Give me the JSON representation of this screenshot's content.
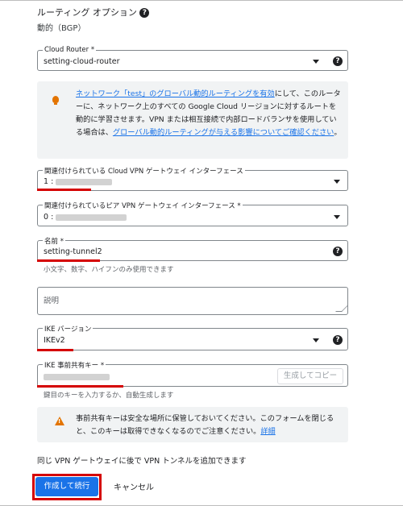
{
  "routing_options": {
    "title": "ルーティング オプション",
    "mode": "動的（BGP）"
  },
  "cloud_router": {
    "label": "Cloud Router *",
    "value": "setting-cloud-router"
  },
  "info": {
    "link1": "ネットワーク「test」のグローバル動的ルーティングを有効",
    "text1": "にして、このルーターに、ネットワーク上のすべての Google Cloud リージョンに対するルートを動的に学習させます。VPN または相互接続で内部ロードバランサを使用している場合は、",
    "link2": "グローバル動的ルーティングが与える影響についてご確認ください",
    "text2": "。"
  },
  "cloud_vpn_interface": {
    "label": "関連付けられている Cloud VPN ゲートウェイ インターフェース",
    "prefix": "1 :"
  },
  "peer_vpn_interface": {
    "label": "関連付けられているピア VPN ゲートウェイ インターフェース *",
    "prefix": "0 :"
  },
  "name": {
    "label": "名前 *",
    "value": "setting-tunnel2",
    "hint": "小文字、数字、ハイフンのみ使用できます"
  },
  "description": {
    "placeholder": "説明"
  },
  "ike_version": {
    "label": "IKE バージョン",
    "value": "IKEv2"
  },
  "ike_key": {
    "label": "IKE 事前共有キー *",
    "generate_label": "生成してコピー",
    "hint": "鍵目のキーを入力するか、自動生成します"
  },
  "warning": {
    "text": "事前共有キーは安全な場所に保管しておいてください。このフォームを閉じると、このキーは取得できなくなるのでご注意ください。",
    "link": "詳細"
  },
  "footer": {
    "note": "同じ VPN ゲートウェイに後で VPN トンネルを追加できます",
    "create_label": "作成して続行",
    "cancel_label": "キャンセル"
  },
  "colors": {
    "primary": "#1a73e8",
    "highlight": "#d50000",
    "warning": "#e37400"
  }
}
